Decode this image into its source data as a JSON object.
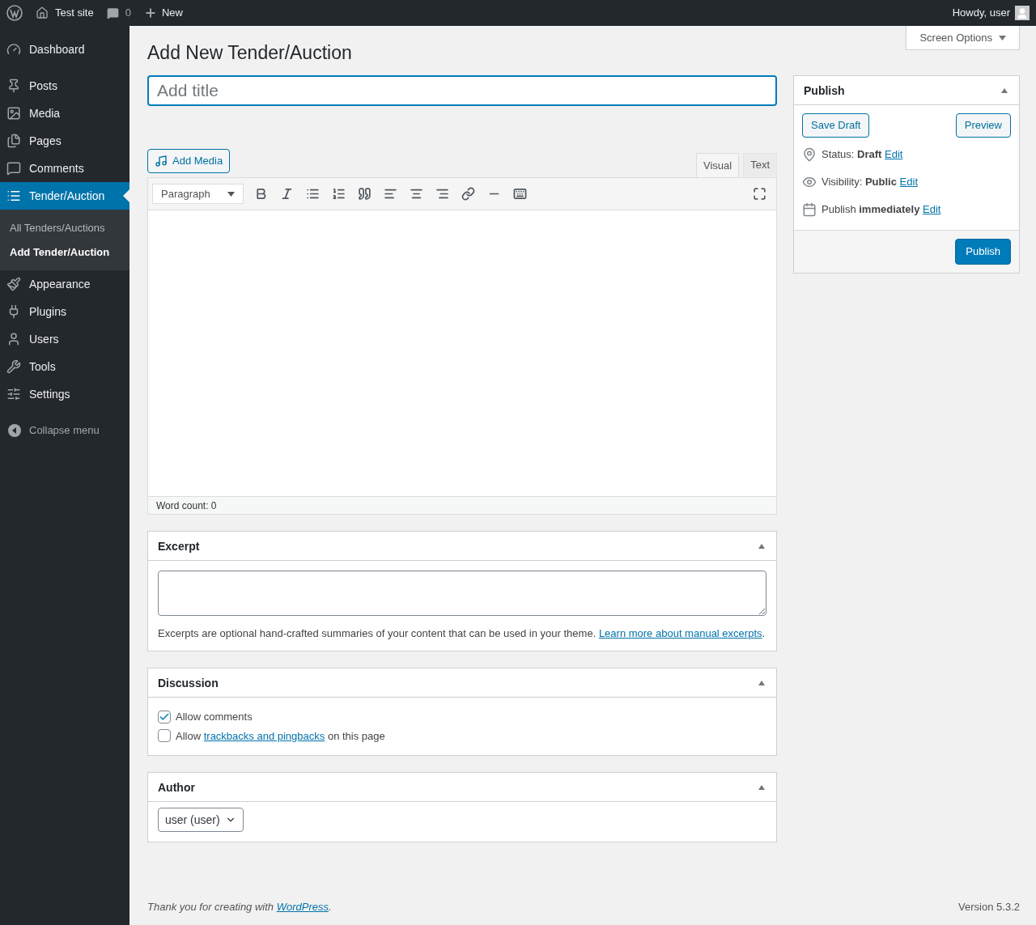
{
  "admin_bar": {
    "site": "Test site",
    "comments": "0",
    "new": "New",
    "greeting": "Howdy, user"
  },
  "sidebar": {
    "groups": [
      {
        "items": [
          {
            "label": "Dashboard",
            "selected": false
          }
        ]
      },
      {
        "items": [
          {
            "label": "Posts",
            "selected": false
          },
          {
            "label": "Media",
            "selected": false
          },
          {
            "label": "Pages",
            "selected": false
          },
          {
            "label": "Comments",
            "selected": false
          },
          {
            "label": "Tender/Auction",
            "selected": true,
            "children": [
              {
                "label": "All Tenders/Auctions",
                "selected": false
              },
              {
                "label": "Add Tender/Auction",
                "selected": true
              }
            ]
          },
          {
            "label": "Appearance",
            "selected": false
          },
          {
            "label": "Plugins",
            "selected": false
          },
          {
            "label": "Users",
            "selected": false
          },
          {
            "label": "Tools",
            "selected": false
          },
          {
            "label": "Settings",
            "selected": false
          }
        ]
      }
    ],
    "collapse": "Collapse menu"
  },
  "screen_options": "Screen Options",
  "page_title": "Add New Tender/Auction",
  "title_field": {
    "placeholder": "Add title"
  },
  "editor": {
    "add_media": "Add Media",
    "tabs": [
      {
        "label": "Visual",
        "selected": true
      },
      {
        "label": "Text",
        "selected": false
      }
    ],
    "format": "Paragraph",
    "word_count": "Word count: 0"
  },
  "publish": {
    "title": "Publish",
    "save_draft": "Save Draft",
    "preview": "Preview",
    "lines": [
      {
        "text": "Status: **Draft**",
        "link": "Edit"
      },
      {
        "text": "Visibility: **Public**",
        "link": "Edit"
      },
      {
        "text": "Publish **immediately**",
        "link": "Edit"
      }
    ],
    "button": "Publish"
  },
  "excerpt": {
    "title": "Excerpt",
    "help": "Excerpts are optional hand-crafted summaries of your content that can be used in your theme.",
    "link": "Learn more about manual excerpts",
    "after": "."
  },
  "discussion": {
    "title": "Discussion",
    "options": [
      {
        "before": "Allow comments",
        "checked": true
      },
      {
        "before": "Allow",
        "link": "trackbacks and pingbacks",
        "after": "on this page",
        "checked": false
      }
    ]
  },
  "author": {
    "title": "Author",
    "value": "user (user)"
  },
  "footer": {
    "text": "Thank you for creating with",
    "link": "WordPress",
    "after": ".",
    "version": "Version 5.3.2"
  }
}
